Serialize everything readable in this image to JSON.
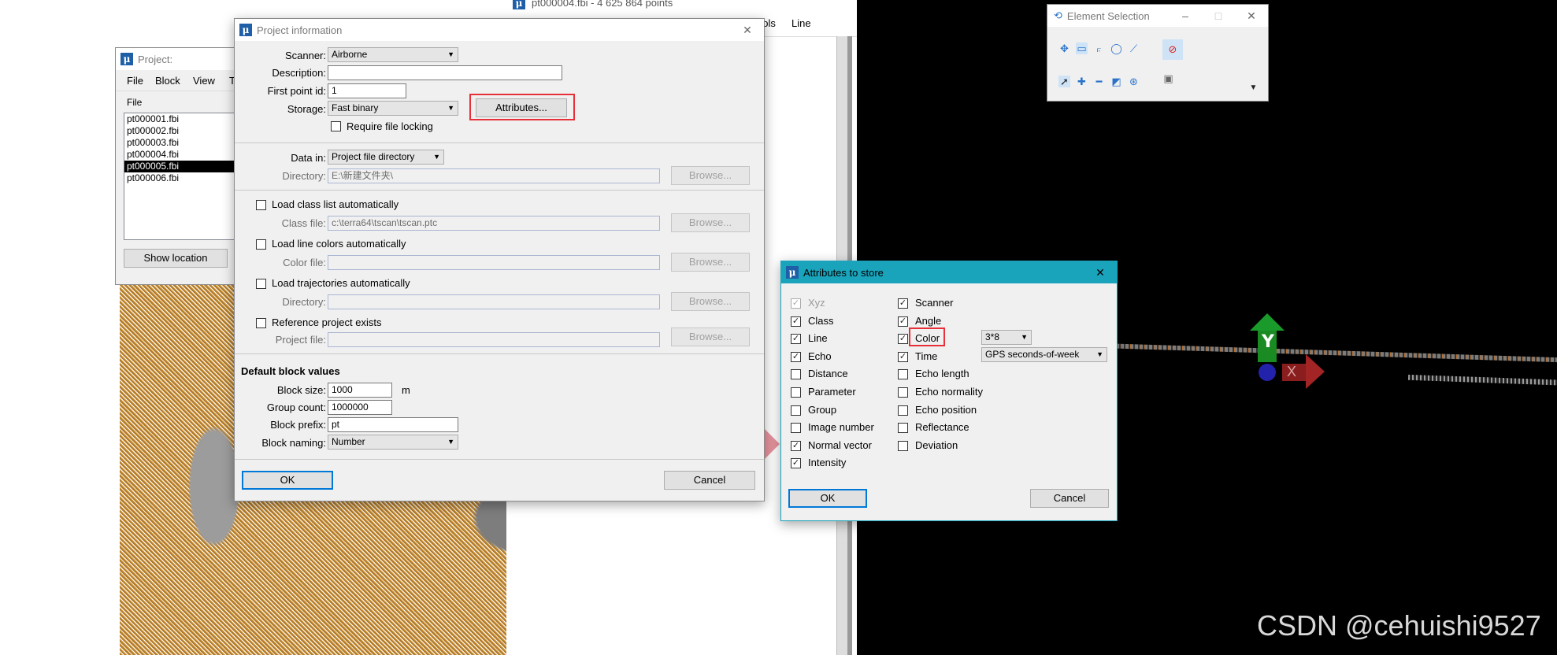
{
  "colors": {
    "accent": "#0078d7",
    "highlight": "#e8303a",
    "teal_title": "#19a4bc"
  },
  "point_view": {
    "title": "pt000004.fbi - 4 625 864 points",
    "menu": [
      "ools",
      "Line"
    ]
  },
  "project_window": {
    "title": "Project:",
    "menu": [
      "File",
      "Block",
      "View",
      "T"
    ],
    "column_header": "File",
    "files": [
      "pt000001.fbi",
      "pt000002.fbi",
      "pt000003.fbi",
      "pt000004.fbi",
      "pt000005.fbi",
      "pt000006.fbi"
    ],
    "selected_index": 4,
    "show_location": "Show location"
  },
  "project_info": {
    "title": "Project information",
    "scanner_label": "Scanner:",
    "scanner_value": "Airborne",
    "description_label": "Description:",
    "description_value": "",
    "first_point_label": "First point id:",
    "first_point_value": "1",
    "storage_label": "Storage:",
    "storage_value": "Fast binary",
    "attributes_button": "Attributes...",
    "require_locking": "Require file locking",
    "data_in_label": "Data in:",
    "data_in_value": "Project file directory",
    "directory_label": "Directory:",
    "directory_value": "E:\\新建文件夹\\",
    "browse": "Browse...",
    "load_class": "Load class list automatically",
    "class_file_label": "Class file:",
    "class_file_value": "c:\\terra64\\tscan\\tscan.ptc",
    "load_colors": "Load line colors automatically",
    "color_file_label": "Color file:",
    "load_traj": "Load trajectories automatically",
    "traj_dir_label": "Directory:",
    "ref_project": "Reference project exists",
    "project_file_label": "Project file:",
    "block_section": "Default block values",
    "block_size_label": "Block size:",
    "block_size_value": "1000",
    "block_size_unit": "m",
    "group_count_label": "Group count:",
    "group_count_value": "1000000",
    "block_prefix_label": "Block prefix:",
    "block_prefix_value": "pt",
    "block_naming_label": "Block naming:",
    "block_naming_value": "Number",
    "ok": "OK",
    "cancel": "Cancel"
  },
  "attributes": {
    "title": "Attributes to store",
    "left": [
      {
        "label": "Xyz",
        "checked": true,
        "disabled": true
      },
      {
        "label": "Class",
        "checked": true
      },
      {
        "label": "Line",
        "checked": true
      },
      {
        "label": "Echo",
        "checked": true
      },
      {
        "label": "Distance",
        "checked": false
      },
      {
        "label": "Parameter",
        "checked": false
      },
      {
        "label": "Group",
        "checked": false
      },
      {
        "label": "Image number",
        "checked": false
      },
      {
        "label": "Normal vector",
        "checked": true
      },
      {
        "label": "Intensity",
        "checked": true
      }
    ],
    "right": [
      {
        "label": "Scanner",
        "checked": true
      },
      {
        "label": "Angle",
        "checked": true
      },
      {
        "label": "Color",
        "checked": true
      },
      {
        "label": "Time",
        "checked": true
      },
      {
        "label": "Echo length",
        "checked": false
      },
      {
        "label": "Echo normality",
        "checked": false
      },
      {
        "label": "Echo position",
        "checked": false
      },
      {
        "label": "Reflectance",
        "checked": false
      },
      {
        "label": "Deviation",
        "checked": false
      }
    ],
    "color_format": "3*8",
    "time_format": "GPS seconds-of-week",
    "ok": "OK",
    "cancel": "Cancel"
  },
  "element_selection": {
    "title": "Element Selection"
  },
  "axis": {
    "y_label": "Y",
    "x_label": "X"
  },
  "watermark": "CSDN @cehuishi9527"
}
